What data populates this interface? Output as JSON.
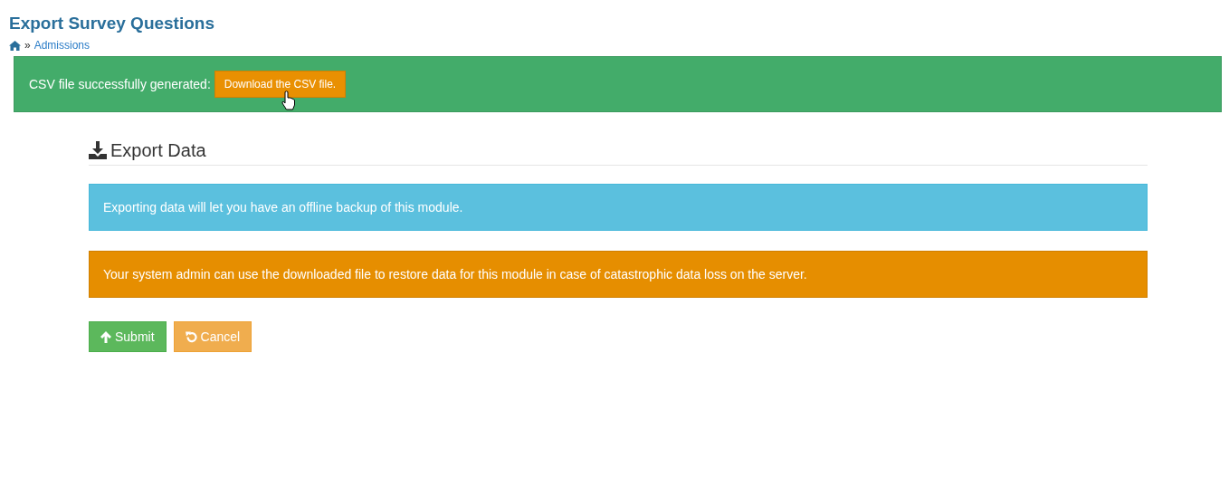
{
  "page_title": "Export Survey Questions",
  "breadcrumb": {
    "separator": "»",
    "items": [
      "Admissions"
    ]
  },
  "success_alert": {
    "text": "CSV file successfully generated:",
    "button": "Download the CSV file."
  },
  "section": {
    "heading": "Export Data"
  },
  "notes": [
    {
      "kind": "info",
      "text": "Exporting data will let you have an offline backup of this module."
    },
    {
      "kind": "warning",
      "text": "Your system admin can use the downloaded file to restore data for this module in case of catastrophic data loss on the server."
    }
  ],
  "buttons": [
    {
      "kind": "submit",
      "label": "Submit"
    },
    {
      "kind": "cancel",
      "label": "Cancel"
    }
  ]
}
